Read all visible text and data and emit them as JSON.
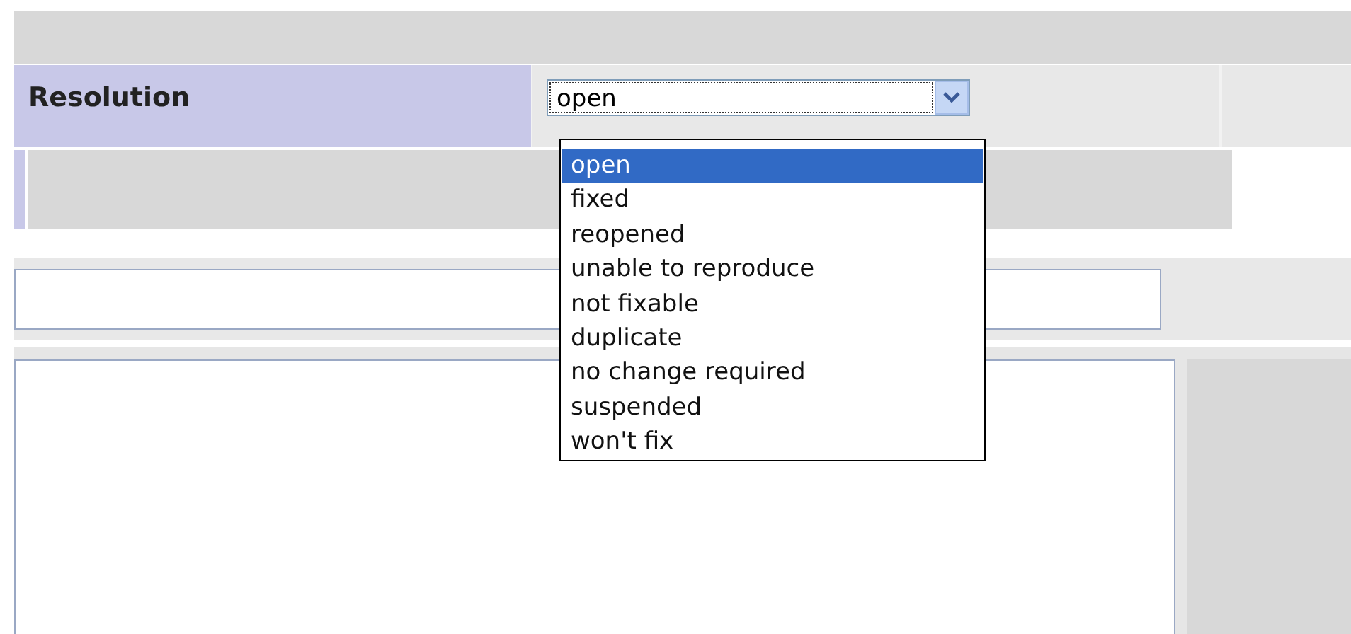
{
  "field": {
    "label": "Resolution",
    "value": "open"
  },
  "dropdown": {
    "options": [
      {
        "label": "open",
        "selected": true
      },
      {
        "label": "fixed",
        "selected": false
      },
      {
        "label": "reopened",
        "selected": false
      },
      {
        "label": "unable to reproduce",
        "selected": false
      },
      {
        "label": "not fixable",
        "selected": false
      },
      {
        "label": "duplicate",
        "selected": false
      },
      {
        "label": "no change required",
        "selected": false
      },
      {
        "label": "suspended",
        "selected": false
      },
      {
        "label": "won't fix",
        "selected": false
      }
    ]
  }
}
